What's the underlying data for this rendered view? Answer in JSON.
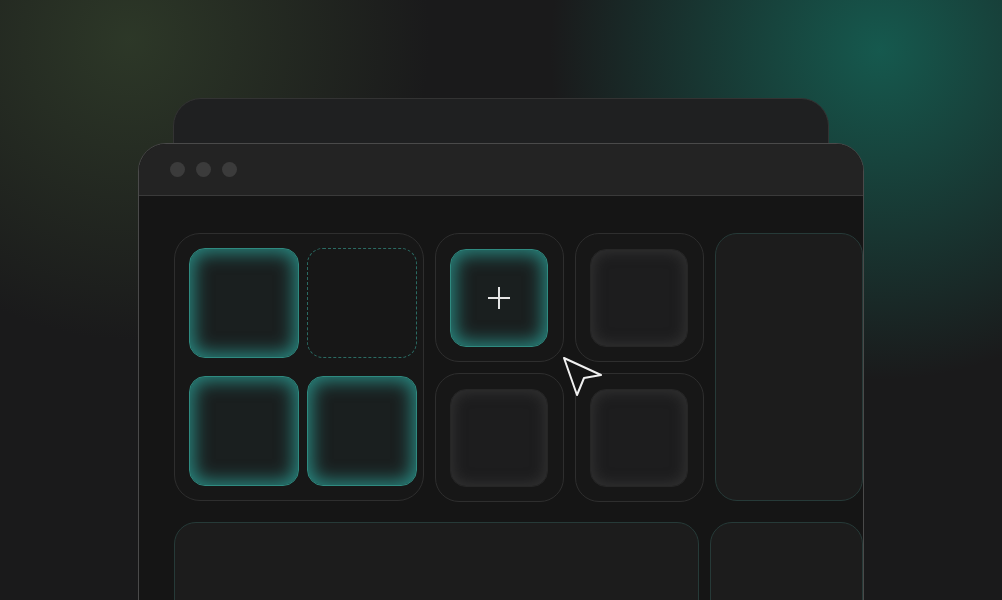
{
  "window": {
    "controls": [
      {
        "kind": "dot"
      },
      {
        "kind": "dot"
      },
      {
        "kind": "dot"
      }
    ]
  },
  "group": {
    "tiles": [
      {
        "kind": "tile",
        "on": true
      },
      {
        "kind": "slot"
      },
      {
        "kind": "tile",
        "on": true
      },
      {
        "kind": "tile",
        "on": true
      }
    ]
  },
  "pads": [
    {
      "kind": "add",
      "on": true
    },
    {
      "kind": "tile",
      "on": false
    },
    {
      "kind": "tile",
      "on": false
    },
    {
      "kind": "tile",
      "on": false
    }
  ],
  "cursor": {
    "kind": "pointer"
  }
}
